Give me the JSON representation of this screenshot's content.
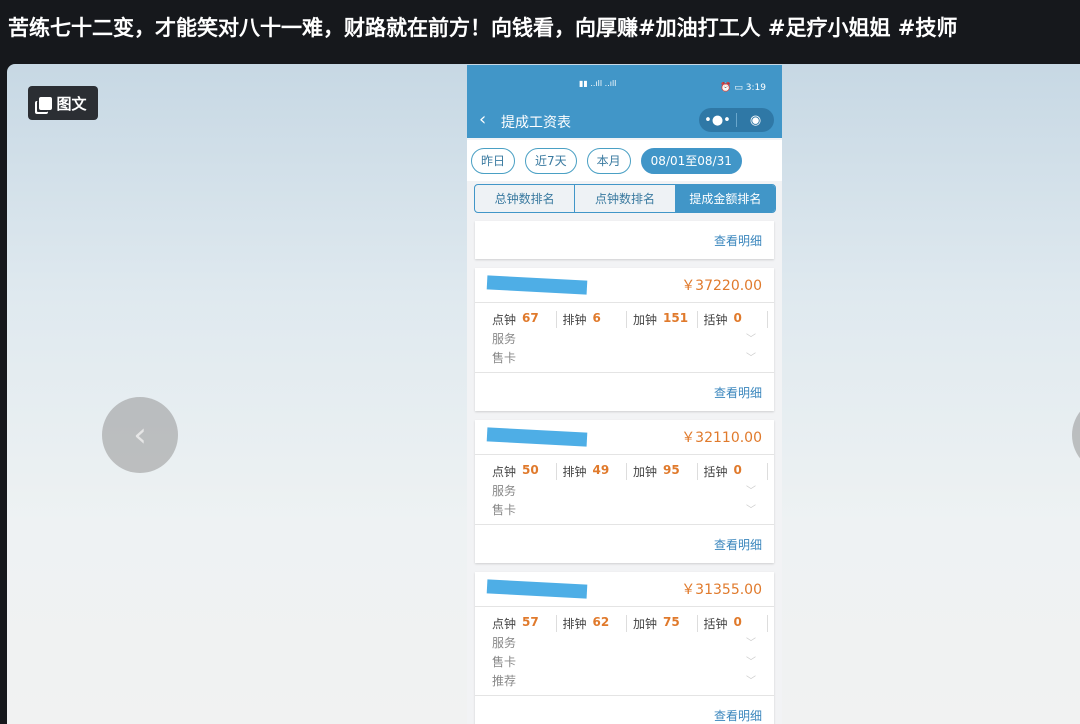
{
  "post_title": "苦练七十二变，才能笑对八十一难，财路就在前方！向钱看，向厚赚#加油打工人 #足疗小姐姐 #技师",
  "badge_label": "图文",
  "phone": {
    "status_time": "3:19",
    "nav_title": "提成工资表",
    "filters": [
      "昨日",
      "近7天",
      "本月",
      "08/01至08/31"
    ],
    "tabs": [
      "总钟数排名",
      "点钟数排名",
      "提成金额排名"
    ],
    "detail_label": "查看明细",
    "stat_labels": [
      "点钟",
      "排钟",
      "加钟",
      "括钟"
    ],
    "cards": [
      {
        "amount": "￥37220.00",
        "stats": [
          "67",
          "6",
          "151",
          "0"
        ],
        "subs": [
          "服务",
          "售卡"
        ]
      },
      {
        "amount": "￥32110.00",
        "stats": [
          "50",
          "49",
          "95",
          "0"
        ],
        "subs": [
          "服务",
          "售卡"
        ]
      },
      {
        "amount": "￥31355.00",
        "stats": [
          "57",
          "62",
          "75",
          "0"
        ],
        "subs": [
          "服务",
          "售卡",
          "推荐"
        ]
      }
    ]
  }
}
